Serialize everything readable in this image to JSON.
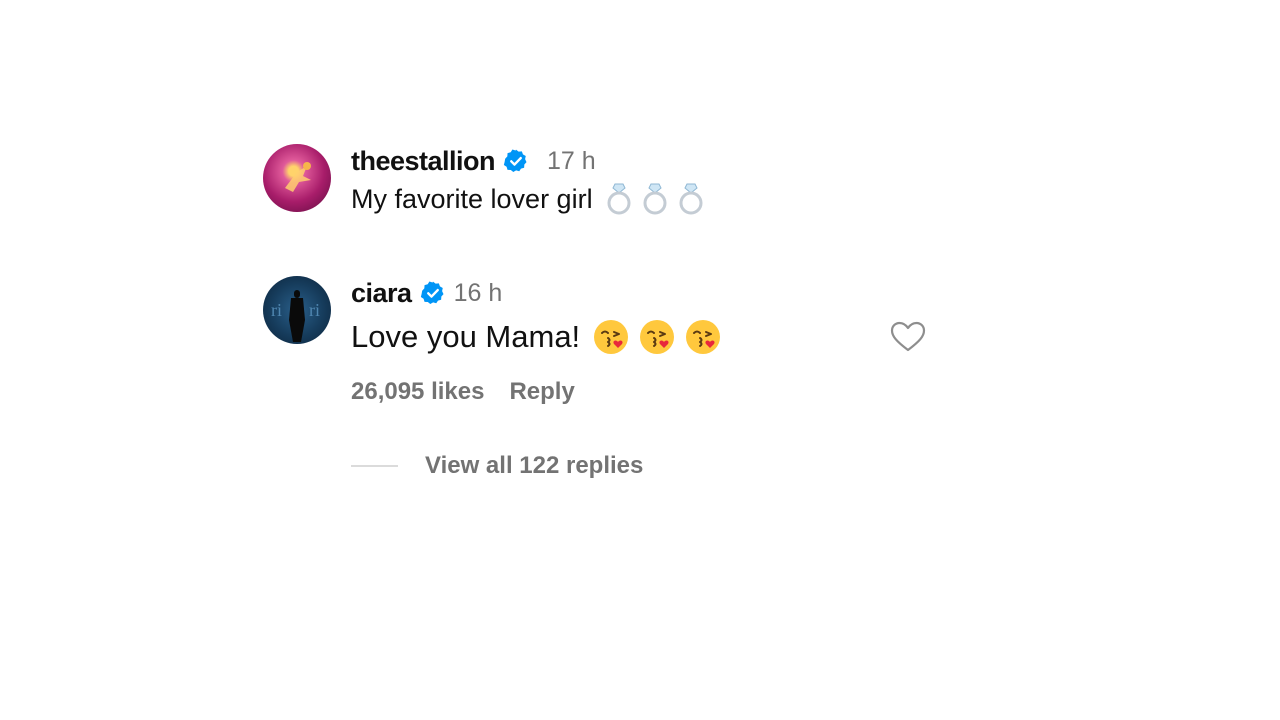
{
  "comments": [
    {
      "username": "theestallion",
      "verified": true,
      "time": "17 h",
      "text": "My favorite lover girl",
      "emojis": [
        "ring-emoji",
        "ring-emoji",
        "ring-emoji"
      ]
    },
    {
      "username": "ciara",
      "verified": true,
      "time": "16 h",
      "text": "Love you Mama!",
      "emojis": [
        "kissing-face-emoji",
        "kissing-face-emoji",
        "kissing-face-emoji"
      ],
      "likes": "26,095 likes",
      "reply_label": "Reply",
      "view_replies_label": "View all 122 replies"
    }
  ],
  "colors": {
    "verified_badge": "#0095f6",
    "secondary_text": "#737373",
    "primary_text": "#111111"
  }
}
